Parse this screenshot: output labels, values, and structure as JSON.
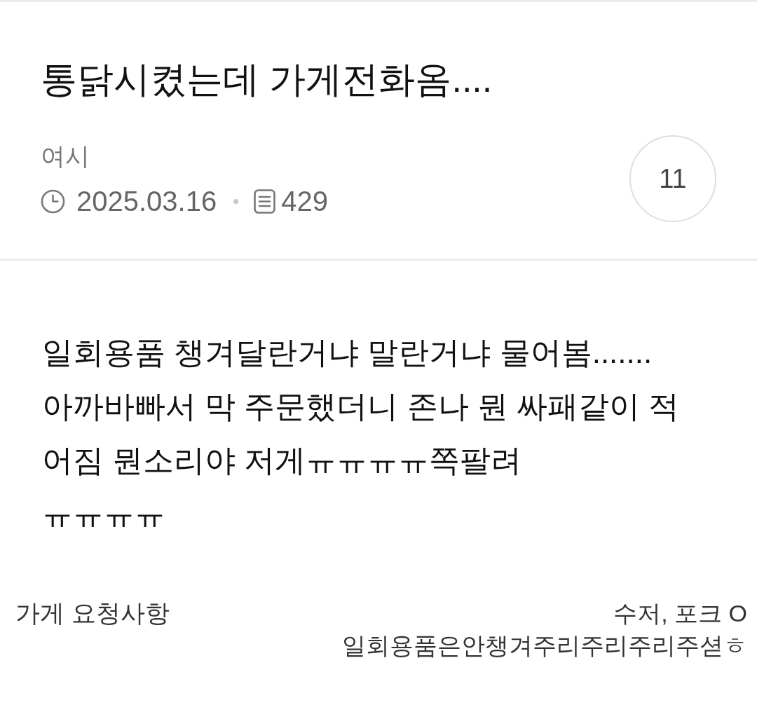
{
  "post": {
    "title": "통닭시켰는데 가게전화옴....",
    "author": "여시",
    "date": "2025.03.16",
    "views": "429",
    "comment_count": "11"
  },
  "body": {
    "text": "일회용품 챙겨달란거냐 말란거냐 물어봄.......\n아까바빠서 막 주문했더니 존나 뭔 싸패같이 적\n어짐 뭔소리야 저게ㅠㅠㅠㅠ쪽팔려\nㅠㅠㅠㅠ"
  },
  "attached_image": {
    "label": "가게 요청사항",
    "request_lines": [
      "수저, 포크 O",
      "일회용품은안챙겨주리주리주리주셛ㅎ"
    ]
  }
}
